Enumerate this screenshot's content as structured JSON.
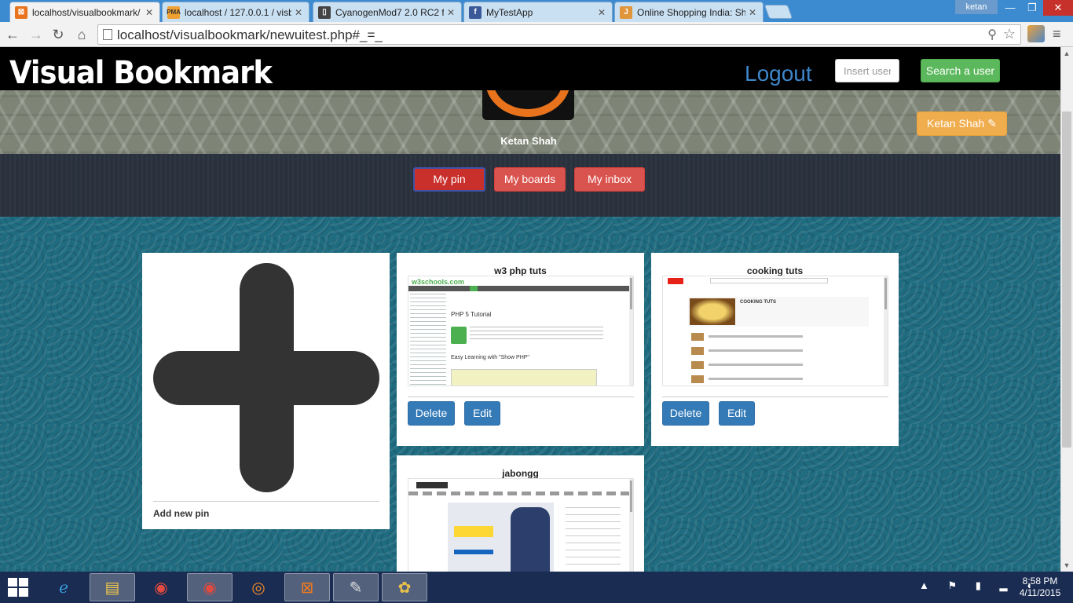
{
  "browser": {
    "tabs": [
      {
        "title": "localhost/visualbookmark/",
        "favicon": "xampp-icon",
        "active": true
      },
      {
        "title": "localhost / 127.0.0.1 / visb",
        "favicon": "phpmyadmin-icon",
        "active": false
      },
      {
        "title": "CyanogenMod7 2.0 RC2 fo",
        "favicon": "phone-icon",
        "active": false
      },
      {
        "title": "MyTestApp",
        "favicon": "facebook-icon",
        "active": false
      },
      {
        "title": "Online Shopping India: Sh",
        "favicon": "jabong-icon",
        "active": false
      }
    ],
    "user_badge": "ketan",
    "url": "localhost/visualbookmark/newuitest.php#_=_"
  },
  "header": {
    "brand": "Visual Bookmark",
    "logout": "Logout",
    "search_placeholder": "Insert user",
    "search_button": "Search a user"
  },
  "profile": {
    "name": "Ketan  Shah",
    "edit_button": "Ketan Shah"
  },
  "nav_tabs": [
    {
      "label": "My pin",
      "active": true
    },
    {
      "label": "My boards",
      "active": false
    },
    {
      "label": "My inbox",
      "active": false
    }
  ],
  "add_pin": {
    "label": "Add new pin"
  },
  "pins": [
    {
      "title": "w3 php tuts",
      "delete": "Delete",
      "edit": "Edit",
      "thumb": {
        "logo": "w3schools",
        "logo_suffix": ".com",
        "heading": "PHP 5 Tutorial",
        "subheading": "Easy Learning with \"Show PHP\""
      }
    },
    {
      "title": "cooking tuts",
      "delete": "Delete",
      "edit": "Edit",
      "thumb": {
        "heading": "COOKING TUTS"
      }
    },
    {
      "title": "jabongg",
      "thumb": {}
    }
  ],
  "taskbar": {
    "apps": [
      "ie-icon",
      "explorer-icon",
      "chrome-icon",
      "chrome-icon",
      "firefox-icon",
      "xampp-icon",
      "notepad-icon",
      "paint-icon"
    ],
    "time": "8:58 PM",
    "date": "4/11/2015"
  },
  "colors": {
    "danger": "#d9534f",
    "primary": "#337ab7",
    "success": "#5cb85c",
    "warning": "#f0ad4e",
    "logout": "#3e86c9"
  }
}
